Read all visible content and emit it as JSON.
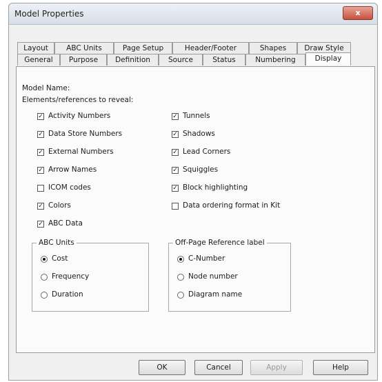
{
  "window": {
    "title": "Model Properties",
    "close_glyph": "x"
  },
  "tabs_row1": [
    "Layout",
    "ABC Units",
    "Page Setup",
    "Header/Footer",
    "Shapes",
    "Draw Style"
  ],
  "tabs_row2": [
    "General",
    "Purpose",
    "Definition",
    "Source",
    "Status",
    "Numbering",
    "Display"
  ],
  "active_tab": "Display",
  "panel": {
    "model_name_label": "Model Name:",
    "elements_label": "Elements/references to reveal:",
    "left_checks": [
      {
        "label": "Activity Numbers",
        "checked": true
      },
      {
        "label": "Data Store Numbers",
        "checked": true
      },
      {
        "label": "External Numbers",
        "checked": true
      },
      {
        "label": "Arrow Names",
        "checked": true
      },
      {
        "label": "ICOM codes",
        "checked": false
      },
      {
        "label": "Colors",
        "checked": true
      },
      {
        "label": "ABC Data",
        "checked": true
      }
    ],
    "right_checks": [
      {
        "label": "Tunnels",
        "checked": true
      },
      {
        "label": "Shadows",
        "checked": true
      },
      {
        "label": "Lead Corners",
        "checked": true
      },
      {
        "label": "Squiggles",
        "checked": true
      },
      {
        "label": "Block highlighting",
        "checked": true
      },
      {
        "label": "Data ordering format in Kit",
        "checked": false
      }
    ],
    "abc_units": {
      "title": "ABC Units",
      "options": [
        {
          "label": "Cost",
          "selected": true
        },
        {
          "label": "Frequency",
          "selected": false
        },
        {
          "label": "Duration",
          "selected": false
        }
      ]
    },
    "offpage": {
      "title": "Off-Page Reference label",
      "options": [
        {
          "label": "C-Number",
          "selected": true
        },
        {
          "label": "Node number",
          "selected": false
        },
        {
          "label": "Diagram name",
          "selected": false
        }
      ]
    }
  },
  "buttons": {
    "ok": "OK",
    "cancel": "Cancel",
    "apply": "Apply",
    "help": "Help"
  }
}
